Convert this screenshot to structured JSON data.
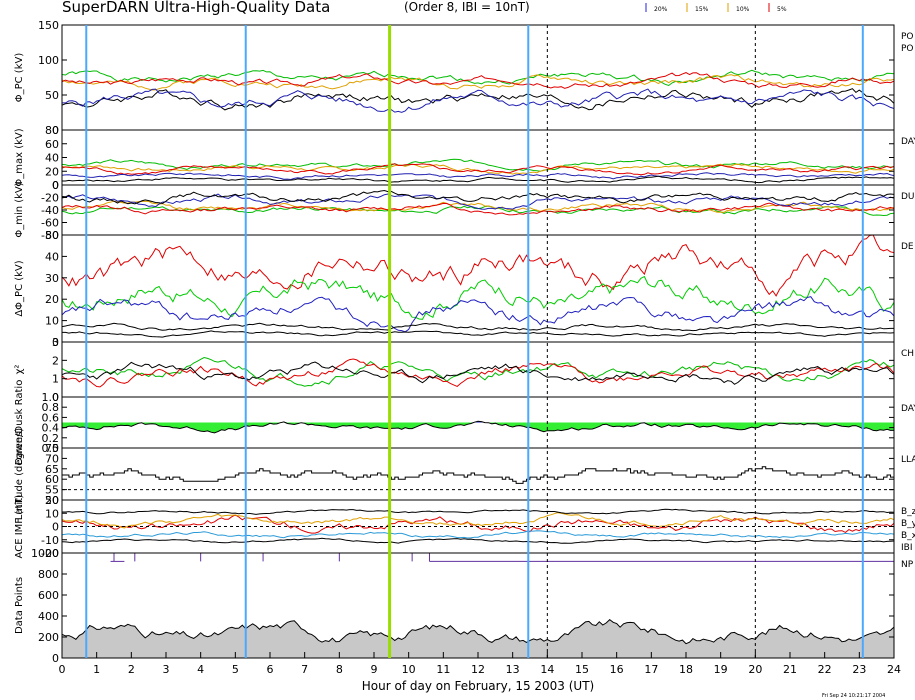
{
  "header": {
    "title": "SuperDARN Ultra-High-Quality Data",
    "subtitle": "(Order 8, IBI = 10nT)",
    "legend": [
      {
        "label": "20%",
        "color": "#2020e0"
      },
      {
        "label": "15%",
        "color": "#e0a000"
      },
      {
        "label": "10%",
        "color": "#e0a000"
      },
      {
        "label": "5%",
        "color": "#e00000"
      }
    ]
  },
  "footer": {
    "xlabel": "Hour of day on February, 15 2003 (UT)",
    "timestamp": "Fri Sep 24 10:21:17 2004"
  },
  "chart_data": {
    "type": "line",
    "x": {
      "min": 0,
      "max": 24,
      "ticks": [
        0,
        1,
        2,
        3,
        4,
        5,
        6,
        7,
        8,
        9,
        10,
        11,
        12,
        13,
        14,
        15,
        16,
        17,
        18,
        19,
        20,
        21,
        22,
        23,
        24
      ]
    },
    "markers": [
      {
        "hour": 0.7,
        "style": "solid",
        "color": "#4aa8ff"
      },
      {
        "hour": 5.3,
        "style": "solid",
        "color": "#4aa8ff"
      },
      {
        "hour": 9.45,
        "style": "solid-thick",
        "color": "#99dd00"
      },
      {
        "hour": 13.45,
        "style": "solid",
        "color": "#4aa8ff"
      },
      {
        "hour": 14.0,
        "style": "dashed",
        "color": "#000000"
      },
      {
        "hour": 20.0,
        "style": "dashed",
        "color": "#000000"
      },
      {
        "hour": 23.1,
        "style": "solid",
        "color": "#4aa8ff"
      }
    ],
    "panels": [
      {
        "ylabel": "Φ_PC (kV)",
        "ylim": [
          0,
          150
        ],
        "yticks": [
          "0",
          "50",
          "100",
          "150"
        ],
        "right_labels": [
          "PO",
          "PO"
        ],
        "series": [
          {
            "color": "#00bb00",
            "base": 75,
            "amp": 12,
            "seed": 1
          },
          {
            "color": "#e0a000",
            "base": 68,
            "amp": 12,
            "seed": 2
          },
          {
            "color": "#e00000",
            "base": 70,
            "amp": 12,
            "seed": 3
          },
          {
            "color": "#000000",
            "base": 45,
            "amp": 18,
            "seed": 4
          },
          {
            "color": "#2020b0",
            "base": 42,
            "amp": 18,
            "seed": 5
          }
        ]
      },
      {
        "ylabel": "Φ_max (kV)",
        "ylim": [
          0,
          80
        ],
        "yticks": [
          "0",
          "20",
          "40",
          "60",
          "80"
        ],
        "right_labels": [
          "DAY"
        ],
        "series": [
          {
            "color": "#00bb00",
            "base": 30,
            "amp": 8,
            "seed": 6
          },
          {
            "color": "#e0a000",
            "base": 25,
            "amp": 8,
            "seed": 7
          },
          {
            "color": "#e00000",
            "base": 22,
            "amp": 8,
            "seed": 8
          },
          {
            "color": "#2020b0",
            "base": 14,
            "amp": 6,
            "seed": 9
          },
          {
            "color": "#000000",
            "base": 8,
            "amp": 5,
            "seed": 10
          }
        ]
      },
      {
        "ylabel": "Φ_min (kV)",
        "ylim": [
          -80,
          0
        ],
        "yticks": [
          "-80",
          "-60",
          "-40",
          "-20",
          "0"
        ],
        "right_labels": [
          "DU"
        ],
        "series": [
          {
            "color": "#00bb00",
            "base": -40,
            "amp": 10,
            "seed": 11
          },
          {
            "color": "#e0a000",
            "base": -35,
            "amp": 10,
            "seed": 12
          },
          {
            "color": "#e00000",
            "base": -38,
            "amp": 10,
            "seed": 13
          },
          {
            "color": "#2020b0",
            "base": -25,
            "amp": 12,
            "seed": 14
          },
          {
            "color": "#000000",
            "base": -20,
            "amp": 12,
            "seed": 15
          }
        ]
      },
      {
        "ylabel": "ΔΦ_PC (kV)",
        "ylim": [
          0,
          50
        ],
        "yticks": [
          "0",
          "10",
          "20",
          "30",
          "40",
          "50"
        ],
        "right_labels": [
          "DE"
        ],
        "series": [
          {
            "color": "#e00000",
            "base": 35,
            "amp": 14,
            "seed": 16
          },
          {
            "color": "#00cc00",
            "base": 22,
            "amp": 12,
            "seed": 17
          },
          {
            "color": "#2020c0",
            "base": 14,
            "amp": 8,
            "seed": 18
          },
          {
            "color": "#000000",
            "base": 7,
            "amp": 2,
            "seed": 19
          },
          {
            "color": "#000000",
            "base": 4,
            "amp": 1.5,
            "seed": 20
          }
        ]
      },
      {
        "ylabel": "χ²",
        "ylim": [
          0,
          3
        ],
        "yticks": [
          "0",
          "1",
          "2",
          "3"
        ],
        "right_labels": [
          "CH"
        ],
        "series": [
          {
            "color": "#00bb00",
            "base": 1.4,
            "amp": 0.7,
            "seed": 21
          },
          {
            "color": "#e00000",
            "base": 1.3,
            "amp": 0.7,
            "seed": 22
          },
          {
            "color": "#000000",
            "base": 1.3,
            "amp": 0.7,
            "seed": 23
          }
        ]
      },
      {
        "ylabel": "Dawn/Dusk Ratio",
        "ylim": [
          0.0,
          1.0
        ],
        "yticks": [
          "0.0",
          "0.2",
          "0.4",
          "0.6",
          "0.8",
          "1.0"
        ],
        "right_labels": [
          "DAY"
        ],
        "fill": {
          "above_color": "#2020c0",
          "below_color": "#33ee33",
          "ref": 0.5
        },
        "series": [
          {
            "color": "#000000",
            "base": 0.42,
            "amp": 0.12,
            "seed": 24
          }
        ]
      },
      {
        "ylabel": "Latitude (degrees)",
        "ylim": [
          50,
          75
        ],
        "yticks": [
          "50",
          "55",
          "60",
          "65",
          "70",
          "75"
        ],
        "right_labels": [
          "LLA"
        ],
        "step": true,
        "dashed_ref": 55,
        "series": [
          {
            "color": "#000000",
            "base": 62,
            "amp": 4,
            "seed": 25
          }
        ]
      },
      {
        "ylabel": "ACE IMF (nT)",
        "ylim": [
          -20,
          20
        ],
        "yticks": [
          "-20",
          "-10",
          "0",
          "10",
          "20"
        ],
        "right_labels": [
          "B_z",
          "B_y",
          "B_x",
          "IBI"
        ],
        "dashed_ref": 0,
        "series": [
          {
            "color": "#e00000",
            "base": 2,
            "amp": 8,
            "seed": 26
          },
          {
            "color": "#e0a000",
            "base": 4,
            "amp": 5,
            "seed": 27
          },
          {
            "color": "#2a9ad8",
            "base": -6,
            "amp": 3,
            "seed": 28
          },
          {
            "color": "#000000",
            "base": 11,
            "amp": 2,
            "seed": 29
          },
          {
            "color": "#000000",
            "base": -11,
            "amp": 2,
            "seed": 30
          }
        ]
      },
      {
        "ylabel": "Data Points",
        "ylim": [
          0,
          1000
        ],
        "yticks": [
          "0",
          "200",
          "400",
          "600",
          "800",
          "1000"
        ],
        "right_labels": [
          "NP"
        ],
        "area": "#c8c8c8",
        "series": [
          {
            "color": "#000000",
            "base": 240,
            "amp": 140,
            "seed": 31
          },
          {
            "color": "#6030a0",
            "kind": "gaps",
            "base": 920,
            "amp": 0,
            "seed": 32
          }
        ]
      }
    ]
  }
}
